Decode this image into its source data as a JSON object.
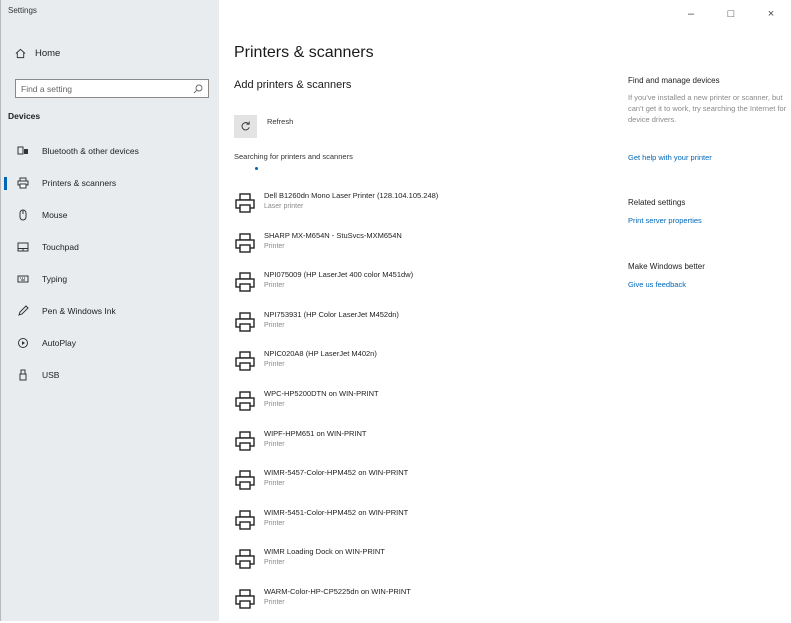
{
  "window": {
    "title": "Settings",
    "minimize": "–",
    "maximize": "□",
    "close": "×"
  },
  "sidebar": {
    "home_label": "Home",
    "search_placeholder": "Find a setting",
    "section_label": "Devices",
    "items": [
      {
        "label": "Bluetooth & other devices",
        "icon": "bluetooth-devices-icon"
      },
      {
        "label": "Printers & scanners",
        "icon": "printer-icon",
        "active": true
      },
      {
        "label": "Mouse",
        "icon": "mouse-icon"
      },
      {
        "label": "Touchpad",
        "icon": "touchpad-icon"
      },
      {
        "label": "Typing",
        "icon": "keyboard-icon"
      },
      {
        "label": "Pen & Windows Ink",
        "icon": "pen-icon"
      },
      {
        "label": "AutoPlay",
        "icon": "autoplay-icon"
      },
      {
        "label": "USB",
        "icon": "usb-icon"
      }
    ]
  },
  "main": {
    "title": "Printers & scanners",
    "subtitle": "Add printers & scanners",
    "refresh_label": "Refresh",
    "searching_text": "Searching for printers and scanners",
    "printers": [
      {
        "name": "Dell B1260dn Mono Laser Printer (128.104.105.248)",
        "type": "Laser printer"
      },
      {
        "name": "SHARP MX-M654N - StuSvcs-MXM654N",
        "type": "Printer"
      },
      {
        "name": "NPI075009 (HP LaserJet 400 color M451dw)",
        "type": "Printer"
      },
      {
        "name": "NPI753931 (HP Color LaserJet M452dn)",
        "type": "Printer"
      },
      {
        "name": "NPIC020A8 (HP LaserJet M402n)",
        "type": "Printer"
      },
      {
        "name": "WPC-HP5200DTN on WIN-PRINT",
        "type": "Printer"
      },
      {
        "name": "WIPF-HPM651 on WIN-PRINT",
        "type": "Printer"
      },
      {
        "name": "WIMR-5457-Color-HPM452 on WIN-PRINT",
        "type": "Printer"
      },
      {
        "name": "WIMR-5451-Color-HPM452 on WIN-PRINT",
        "type": "Printer"
      },
      {
        "name": "WIMR Loading Dock on WIN-PRINT",
        "type": "Printer"
      },
      {
        "name": "WARM-Color-HP-CP5225dn on WIN-PRINT",
        "type": "Printer"
      }
    ]
  },
  "right_panel": {
    "find_heading": "Find and manage devices",
    "find_desc": "If you've installed a new printer or scanner, but can't get it to work, try searching the Internet for device drivers.",
    "help_link": "Get help with your printer",
    "related_heading": "Related settings",
    "print_server_link": "Print server properties",
    "better_heading": "Make Windows better",
    "feedback_link": "Give us feedback"
  },
  "colors": {
    "accent": "#0067b8",
    "sidebar_bg": "#e9ecef"
  }
}
